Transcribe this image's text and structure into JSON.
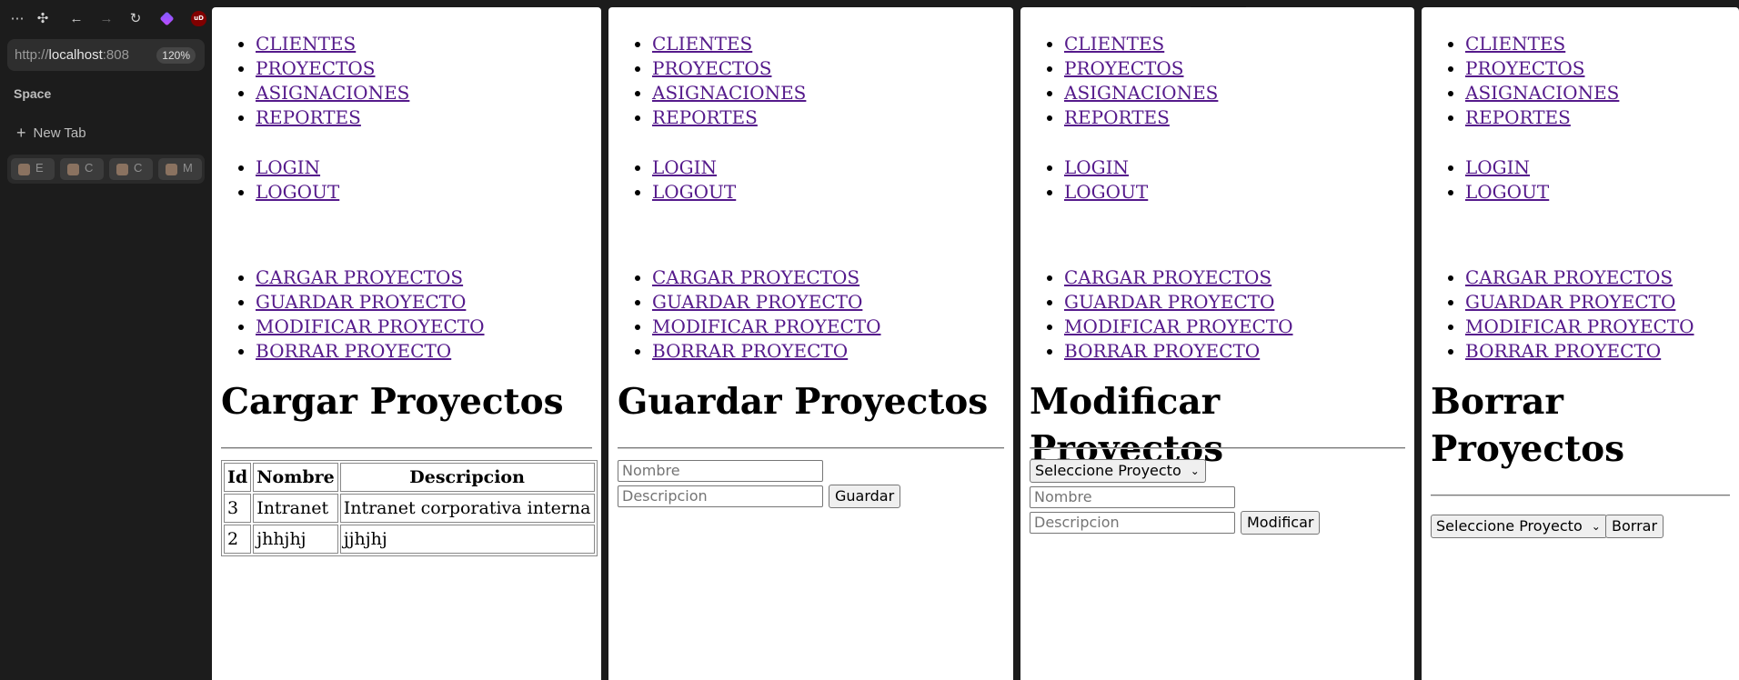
{
  "browser": {
    "url_scheme": "http://",
    "url_host": "localhost",
    "url_rest": ":808",
    "zoom": "120%",
    "space_label": "Space",
    "new_tab_label": "New Tab",
    "pinned_tabs": [
      "E",
      "C",
      "C",
      "M"
    ],
    "ublock_label": "uD"
  },
  "nav": {
    "main": [
      "CLIENTES",
      "PROYECTOS",
      "ASIGNACIONES",
      "REPORTES"
    ],
    "auth": [
      "LOGIN",
      "LOGOUT"
    ],
    "proyectos": [
      "CARGAR PROYECTOS",
      "GUARDAR PROYECTO",
      "MODIFICAR PROYECTO",
      "BORRAR PROYECTO"
    ]
  },
  "cargar": {
    "title": "Cargar Proyectos",
    "table": {
      "headers": [
        "Id",
        "Nombre",
        "Descripcion"
      ],
      "rows": [
        [
          "3",
          "Intranet",
          "Intranet corporativa interna"
        ],
        [
          "2",
          "jhhjhj",
          "jjhjhj"
        ]
      ]
    }
  },
  "guardar": {
    "title": "Guardar Proyectos",
    "nombre_placeholder": "Nombre",
    "descripcion_placeholder": "Descripcion",
    "button": "Guardar"
  },
  "modificar": {
    "title": "Modificar Proyectos",
    "select_value": "Seleccione Proyecto",
    "nombre_placeholder": "Nombre",
    "descripcion_placeholder": "Descripcion",
    "button": "Modificar"
  },
  "borrar": {
    "title_line1": "Borrar",
    "title_line2": "Proyectos",
    "select_value": "Seleccione Proyecto",
    "button": "Borrar"
  },
  "colors": {
    "link": "#551a8b",
    "chrome_bg": "#1c1c1c",
    "page_bg": "#ffffff"
  }
}
